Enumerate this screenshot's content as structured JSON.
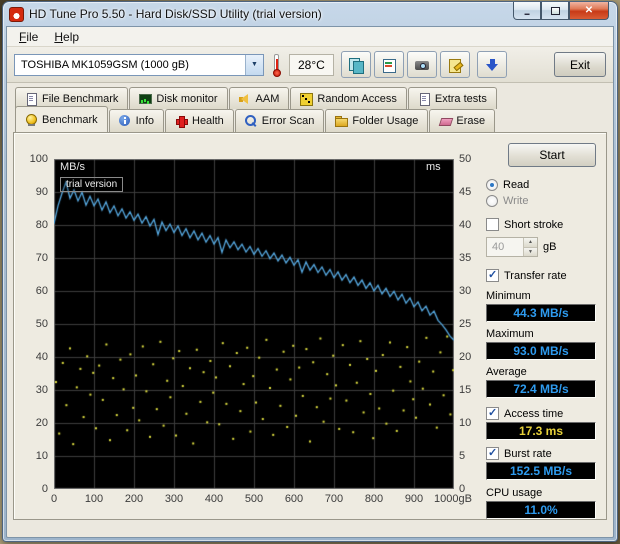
{
  "window": {
    "title": "HD Tune Pro 5.50 - Hard Disk/SSD Utility (trial version)"
  },
  "menu": {
    "items": [
      "File",
      "Help"
    ]
  },
  "toolbar": {
    "drive_select": "TOSHIBA MK1059GSM (1000 gB)",
    "temperature": "28°C",
    "icons": [
      "copy-icon",
      "report-icon",
      "camera-icon",
      "export-icon",
      "save-icon"
    ],
    "exit_label": "Exit"
  },
  "tabs": {
    "row1": [
      "File Benchmark",
      "Disk monitor",
      "AAM",
      "Random Access",
      "Extra tests"
    ],
    "row2": [
      "Benchmark",
      "Info",
      "Health",
      "Error Scan",
      "Folder Usage",
      "Erase"
    ],
    "active": "Benchmark"
  },
  "chart": {
    "watermark": "trial version",
    "left_axis": {
      "label": "MB/s",
      "min": 0,
      "max": 100,
      "step": 10
    },
    "right_axis": {
      "label": "ms",
      "min": 0,
      "max": 50,
      "step": 5
    },
    "x_axis": {
      "min": 0,
      "max": 1000,
      "step": 100,
      "last_label": "1000gB"
    },
    "colors": {
      "plot_bg": "#000000",
      "grid": "#3d3d3d",
      "border": "#777777",
      "line": "#55a8e0",
      "scatter": "#e0e040"
    }
  },
  "chart_data": {
    "type": "line",
    "xlabel": "gB",
    "x_range": [
      0,
      1000
    ],
    "left_ylim": [
      0,
      100
    ],
    "right_ylim": [
      0,
      50
    ],
    "grid": true,
    "series": [
      {
        "name": "Transfer rate (MB/s)",
        "type": "line",
        "axis": "left",
        "x_start": 0,
        "x_step": 10,
        "values": [
          80.4,
          85.8,
          89.6,
          93.0,
          88.1,
          90.6,
          87.3,
          89.9,
          86.0,
          88.7,
          85.8,
          87.9,
          84.5,
          87.0,
          83.7,
          85.8,
          82.8,
          84.9,
          82.1,
          84.0,
          81.4,
          83.3,
          80.6,
          82.5,
          79.7,
          81.7,
          77.1,
          80.9,
          78.3,
          80.3,
          77.7,
          79.7,
          76.8,
          78.9,
          76.1,
          78.2,
          75.5,
          77.5,
          74.8,
          76.8,
          74.2,
          76.2,
          71.7,
          75.5,
          73.1,
          74.9,
          72.5,
          74.2,
          71.8,
          73.5,
          71.1,
          72.9,
          70.5,
          72.2,
          69.8,
          71.5,
          69.1,
          70.9,
          68.5,
          70.2,
          67.8,
          69.5,
          65.7,
          68.8,
          66.3,
          68.0,
          65.6,
          67.3,
          64.8,
          66.5,
          64.0,
          65.8,
          63.3,
          65.0,
          62.5,
          64.2,
          61.7,
          63.3,
          60.8,
          62.5,
          60.0,
          61.7,
          59.1,
          60.8,
          58.3,
          59.9,
          57.3,
          59.0,
          56.3,
          57.9,
          55.2,
          56.7,
          54.0,
          55.4,
          52.7,
          53.9,
          51.1,
          49.8,
          48.2,
          46.3,
          45.1
        ]
      },
      {
        "name": "Access time (ms)",
        "type": "scatter",
        "axis": "right",
        "points": [
          [
            5,
            16.2
          ],
          [
            13,
            8.4
          ],
          [
            22,
            19.1
          ],
          [
            31,
            12.7
          ],
          [
            40,
            21.3
          ],
          [
            48,
            6.8
          ],
          [
            57,
            15.4
          ],
          [
            66,
            18.2
          ],
          [
            74,
            10.9
          ],
          [
            83,
            20.1
          ],
          [
            91,
            14.3
          ],
          [
            98,
            17.6
          ],
          [
            105,
            9.2
          ],
          [
            113,
            18.7
          ],
          [
            122,
            13.5
          ],
          [
            131,
            21.9
          ],
          [
            140,
            7.4
          ],
          [
            148,
            16.8
          ],
          [
            157,
            11.2
          ],
          [
            166,
            19.6
          ],
          [
            174,
            15.1
          ],
          [
            183,
            8.9
          ],
          [
            191,
            20.4
          ],
          [
            198,
            12.3
          ],
          [
            205,
            17.2
          ],
          [
            213,
            10.4
          ],
          [
            222,
            21.6
          ],
          [
            231,
            14.8
          ],
          [
            240,
            7.9
          ],
          [
            248,
            18.9
          ],
          [
            257,
            12.1
          ],
          [
            266,
            22.3
          ],
          [
            274,
            9.6
          ],
          [
            283,
            16.4
          ],
          [
            291,
            13.9
          ],
          [
            298,
            19.8
          ],
          [
            305,
            8.1
          ],
          [
            313,
            20.9
          ],
          [
            322,
            15.6
          ],
          [
            331,
            11.4
          ],
          [
            340,
            18.3
          ],
          [
            348,
            6.9
          ],
          [
            357,
            21.1
          ],
          [
            366,
            13.2
          ],
          [
            374,
            17.7
          ],
          [
            383,
            10.1
          ],
          [
            391,
            19.4
          ],
          [
            398,
            14.6
          ],
          [
            405,
            16.9
          ],
          [
            413,
            9.8
          ],
          [
            422,
            22.1
          ],
          [
            431,
            12.9
          ],
          [
            440,
            18.6
          ],
          [
            448,
            7.6
          ],
          [
            457,
            20.6
          ],
          [
            466,
            11.8
          ],
          [
            474,
            15.9
          ],
          [
            483,
            21.4
          ],
          [
            491,
            8.7
          ],
          [
            498,
            17.1
          ],
          [
            505,
            13.1
          ],
          [
            513,
            19.9
          ],
          [
            522,
            10.6
          ],
          [
            531,
            22.6
          ],
          [
            540,
            15.3
          ],
          [
            548,
            8.2
          ],
          [
            557,
            18.1
          ],
          [
            566,
            12.6
          ],
          [
            574,
            20.8
          ],
          [
            583,
            9.4
          ],
          [
            591,
            16.6
          ],
          [
            598,
            21.7
          ],
          [
            605,
            11.1
          ],
          [
            613,
            18.4
          ],
          [
            622,
            14.1
          ],
          [
            631,
            21.2
          ],
          [
            640,
            7.2
          ],
          [
            648,
            19.2
          ],
          [
            657,
            12.4
          ],
          [
            666,
            22.8
          ],
          [
            674,
            10.2
          ],
          [
            683,
            17.4
          ],
          [
            691,
            13.7
          ],
          [
            698,
            20.2
          ],
          [
            705,
            15.7
          ],
          [
            713,
            9.1
          ],
          [
            722,
            21.8
          ],
          [
            731,
            13.4
          ],
          [
            740,
            18.8
          ],
          [
            748,
            8.6
          ],
          [
            757,
            16.1
          ],
          [
            766,
            22.4
          ],
          [
            774,
            11.6
          ],
          [
            783,
            19.7
          ],
          [
            791,
            14.4
          ],
          [
            798,
            7.7
          ],
          [
            805,
            17.9
          ],
          [
            813,
            12.2
          ],
          [
            822,
            20.3
          ],
          [
            831,
            9.9
          ],
          [
            840,
            22.2
          ],
          [
            848,
            14.9
          ],
          [
            857,
            8.8
          ],
          [
            866,
            18.5
          ],
          [
            874,
            11.9
          ],
          [
            883,
            21.5
          ],
          [
            891,
            16.3
          ],
          [
            898,
            13.6
          ],
          [
            905,
            10.8
          ],
          [
            913,
            19.3
          ],
          [
            922,
            15.2
          ],
          [
            931,
            22.9
          ],
          [
            940,
            12.8
          ],
          [
            948,
            17.8
          ],
          [
            957,
            9.3
          ],
          [
            966,
            20.7
          ],
          [
            974,
            14.2
          ],
          [
            983,
            23.1
          ],
          [
            991,
            11.3
          ],
          [
            998,
            18.0
          ]
        ]
      }
    ]
  },
  "side_panel": {
    "start_label": "Start",
    "read_label": "Read",
    "write_label": "Write",
    "short_stroke_label": "Short stroke",
    "stroke_value": "40",
    "stroke_unit": "gB",
    "transfer_rate_label": "Transfer rate",
    "minimum_label": "Minimum",
    "minimum_value": "44.3 MB/s",
    "maximum_label": "Maximum",
    "maximum_value": "93.0 MB/s",
    "average_label": "Average",
    "average_value": "72.4 MB/s",
    "access_time_label": "Access time",
    "access_time_value": "17.3 ms",
    "burst_rate_label": "Burst rate",
    "burst_rate_value": "152.5 MB/s",
    "cpu_usage_label": "CPU usage",
    "cpu_usage_value": "11.0%"
  }
}
